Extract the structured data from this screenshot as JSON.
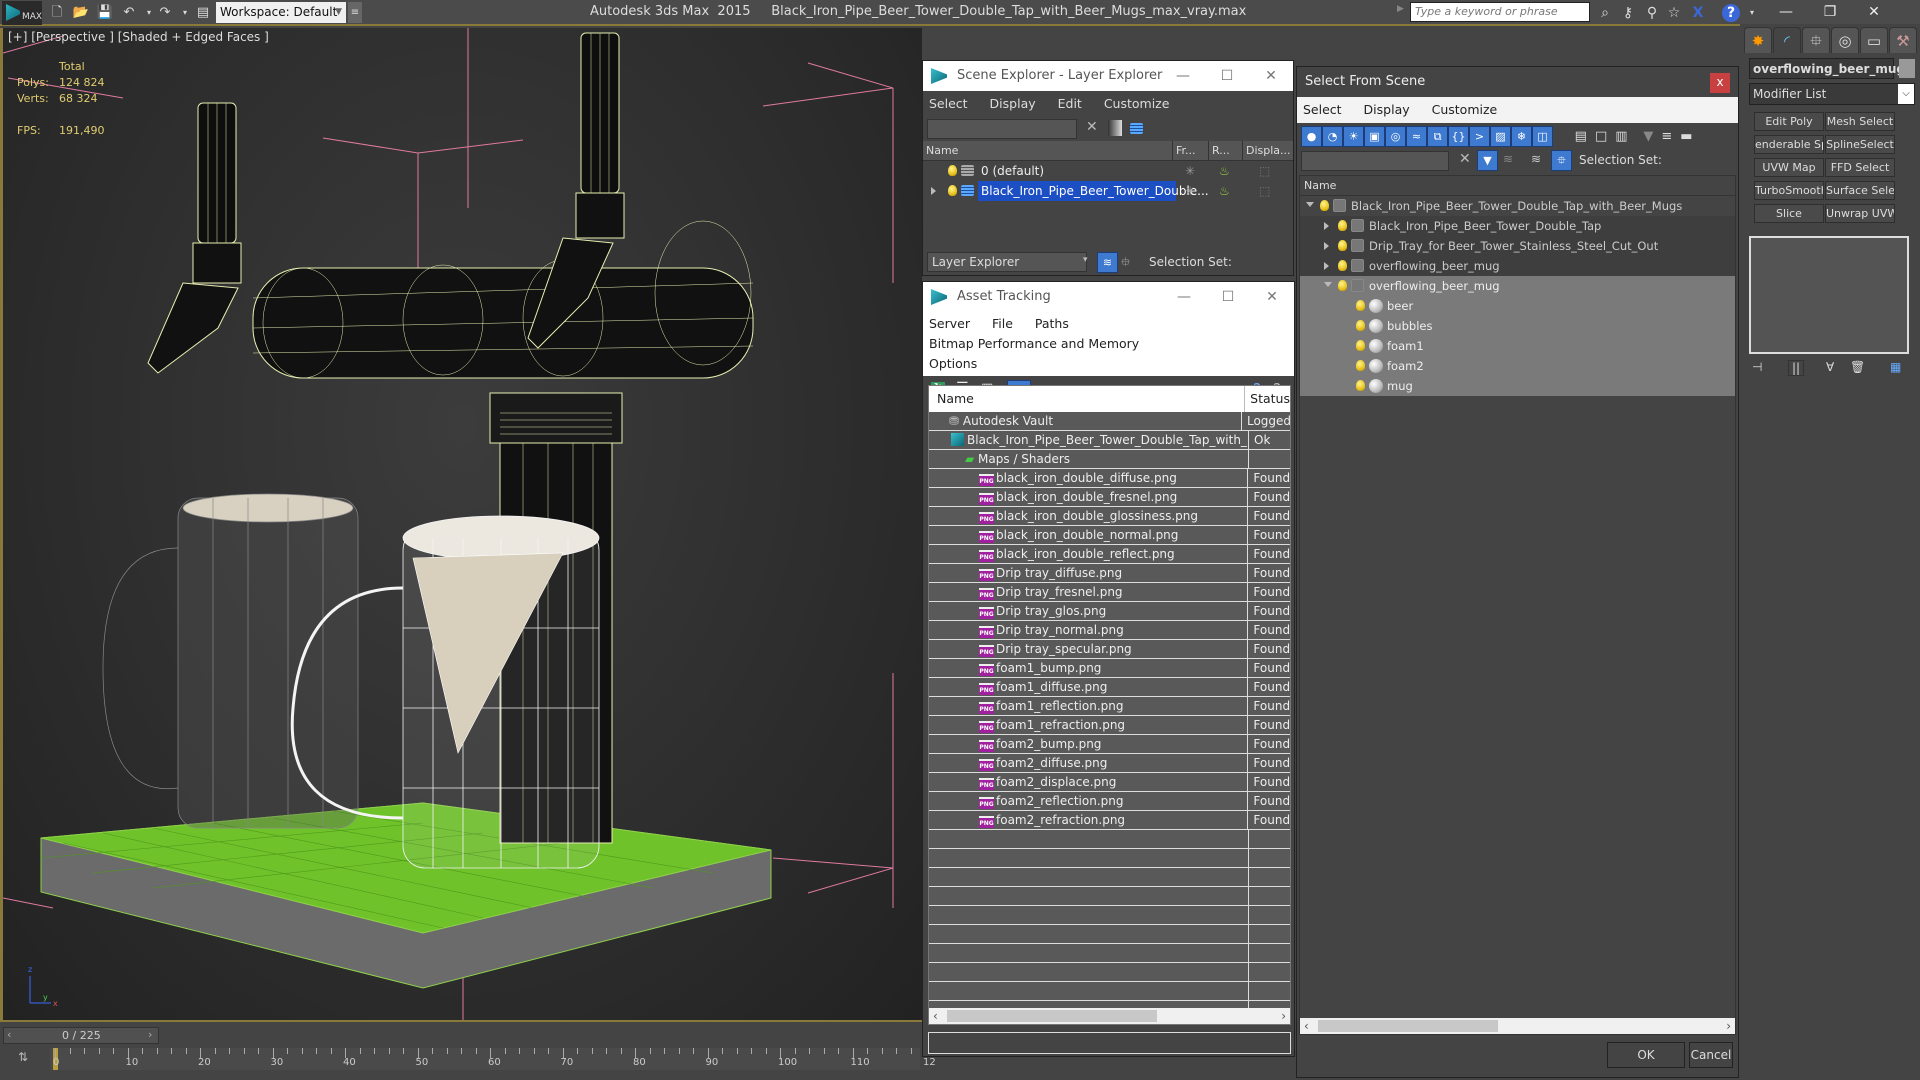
{
  "titlebar": {
    "logo_text": "MAX",
    "workspace": "Workspace: Default",
    "app_name": "Autodesk 3ds Max  2015",
    "file_name": "Black_Iron_Pipe_Beer_Tower_Double_Tap_with_Beer_Mugs_max_vray.max",
    "search_placeholder": "Type a keyword or phrase",
    "window_controls": [
      "minimize",
      "restore",
      "close"
    ]
  },
  "viewport": {
    "label": "[+] [Perspective ] [Shaded + Edged Faces ]",
    "stats": {
      "total_label": "Total",
      "polys_label": "Polys:",
      "polys_value": "124 824",
      "verts_label": "Verts:",
      "verts_value": "68 324",
      "fps_label": "FPS:",
      "fps_value": "191,490"
    }
  },
  "scene_explorer": {
    "title": "Scene Explorer - Layer Explorer",
    "menu": [
      "Select",
      "Display",
      "Edit",
      "Customize"
    ],
    "columns": [
      "Name",
      "Fr...",
      "R...",
      "Displa..."
    ],
    "rows": [
      {
        "name": "0 (default)",
        "selected": false,
        "expandable": false
      },
      {
        "name": "Black_Iron_Pipe_Beer_Tower_Double...",
        "selected": true,
        "expandable": true
      }
    ],
    "footer_dropdown": "Layer Explorer",
    "selection_set_label": "Selection Set:"
  },
  "asset_tracking": {
    "title": "Asset Tracking",
    "menu": [
      "Server",
      "File",
      "Paths",
      "Bitmap Performance and Memory",
      "Options"
    ],
    "columns": [
      "Name",
      "Status"
    ],
    "rows": [
      {
        "name": "Autodesk Vault",
        "status": "Logged",
        "level": 1,
        "icon": "vault"
      },
      {
        "name": "Black_Iron_Pipe_Beer_Tower_Double_Tap_with_B...",
        "status": "Ok",
        "level": 2,
        "icon": "max"
      },
      {
        "name": "Maps / Shaders",
        "status": "",
        "level": 3,
        "icon": "maps"
      },
      {
        "name": "black_iron_double_diffuse.png",
        "status": "Found",
        "level": 4,
        "icon": "png"
      },
      {
        "name": "black_iron_double_fresnel.png",
        "status": "Found",
        "level": 4,
        "icon": "png"
      },
      {
        "name": "black_iron_double_glossiness.png",
        "status": "Found",
        "level": 4,
        "icon": "png"
      },
      {
        "name": "black_iron_double_normal.png",
        "status": "Found",
        "level": 4,
        "icon": "png"
      },
      {
        "name": "black_iron_double_reflect.png",
        "status": "Found",
        "level": 4,
        "icon": "png"
      },
      {
        "name": "Drip tray_diffuse.png",
        "status": "Found",
        "level": 4,
        "icon": "png"
      },
      {
        "name": "Drip tray_fresnel.png",
        "status": "Found",
        "level": 4,
        "icon": "png"
      },
      {
        "name": "Drip tray_glos.png",
        "status": "Found",
        "level": 4,
        "icon": "png"
      },
      {
        "name": "Drip tray_normal.png",
        "status": "Found",
        "level": 4,
        "icon": "png"
      },
      {
        "name": "Drip tray_specular.png",
        "status": "Found",
        "level": 4,
        "icon": "png"
      },
      {
        "name": "foam1_bump.png",
        "status": "Found",
        "level": 4,
        "icon": "png"
      },
      {
        "name": "foam1_diffuse.png",
        "status": "Found",
        "level": 4,
        "icon": "png"
      },
      {
        "name": "foam1_reflection.png",
        "status": "Found",
        "level": 4,
        "icon": "png"
      },
      {
        "name": "foam1_refraction.png",
        "status": "Found",
        "level": 4,
        "icon": "png"
      },
      {
        "name": "foam2_bump.png",
        "status": "Found",
        "level": 4,
        "icon": "png"
      },
      {
        "name": "foam2_diffuse.png",
        "status": "Found",
        "level": 4,
        "icon": "png"
      },
      {
        "name": "foam2_displace.png",
        "status": "Found",
        "level": 4,
        "icon": "png"
      },
      {
        "name": "foam2_reflection.png",
        "status": "Found",
        "level": 4,
        "icon": "png"
      },
      {
        "name": "foam2_refraction.png",
        "status": "Found",
        "level": 4,
        "icon": "png"
      }
    ],
    "empty_rows": 11
  },
  "select_from_scene": {
    "title": "Select From Scene",
    "close_label": "x",
    "menu": [
      "Select",
      "Display",
      "Customize"
    ],
    "selection_set_label": "Selection Set:",
    "column_name": "Name",
    "tree": [
      {
        "name": "Black_Iron_Pipe_Beer_Tower_Double_Tap_with_Beer_Mugs",
        "level": 0,
        "expand": "open",
        "icon": "group",
        "highlight": false
      },
      {
        "name": "Black_Iron_Pipe_Beer_Tower_Double_Tap",
        "level": 1,
        "expand": "closed",
        "icon": "group",
        "highlight": false
      },
      {
        "name": "Drip_Tray_for Beer_Tower_Stainless_Steel_Cut_Out",
        "level": 1,
        "expand": "closed",
        "icon": "group",
        "highlight": false
      },
      {
        "name": "overflowing_beer_mug",
        "level": 1,
        "expand": "closed",
        "icon": "group",
        "highlight": false
      },
      {
        "name": "overflowing_beer_mug",
        "level": 1,
        "expand": "open",
        "icon": "group",
        "highlight": true
      },
      {
        "name": "beer",
        "level": 2,
        "expand": "none",
        "icon": "geometry",
        "highlight": true
      },
      {
        "name": "bubbles",
        "level": 2,
        "expand": "none",
        "icon": "geometry",
        "highlight": true
      },
      {
        "name": "foam1",
        "level": 2,
        "expand": "none",
        "icon": "geometry",
        "highlight": true
      },
      {
        "name": "foam2",
        "level": 2,
        "expand": "none",
        "icon": "geometry",
        "highlight": true
      },
      {
        "name": "mug",
        "level": 2,
        "expand": "none",
        "icon": "geometry",
        "highlight": true
      }
    ],
    "ok_label": "OK",
    "cancel_label": "Cancel"
  },
  "command_panel": {
    "tabs": [
      "create",
      "modify",
      "hierarchy",
      "motion",
      "display",
      "utilities"
    ],
    "object_name": "overflowing_beer_mug",
    "modifier_list": "Modifier List",
    "modifier_buttons": [
      "Edit Poly",
      "Mesh Select",
      "enderable Splin",
      "SplineSelect",
      "UVW Map",
      "FFD Select",
      "TurboSmooth",
      "Surface Select",
      "Slice",
      "Unwrap UVW"
    ]
  },
  "timeline": {
    "frame_display": "0 / 225",
    "current_frame": 0,
    "total_frames": 225,
    "tick_labels": [
      "0",
      "10",
      "20",
      "30",
      "40",
      "50",
      "60",
      "70",
      "80",
      "90",
      "100",
      "110",
      "12"
    ]
  },
  "colors": {
    "accent_gold": "#8a7a3a",
    "selection_blue": "#1c4fc4",
    "stat_text": "#e0cc70",
    "wire_yellow": "#e8eeb0",
    "tray_green": "#6fc22a",
    "close_red": "#c94040"
  }
}
